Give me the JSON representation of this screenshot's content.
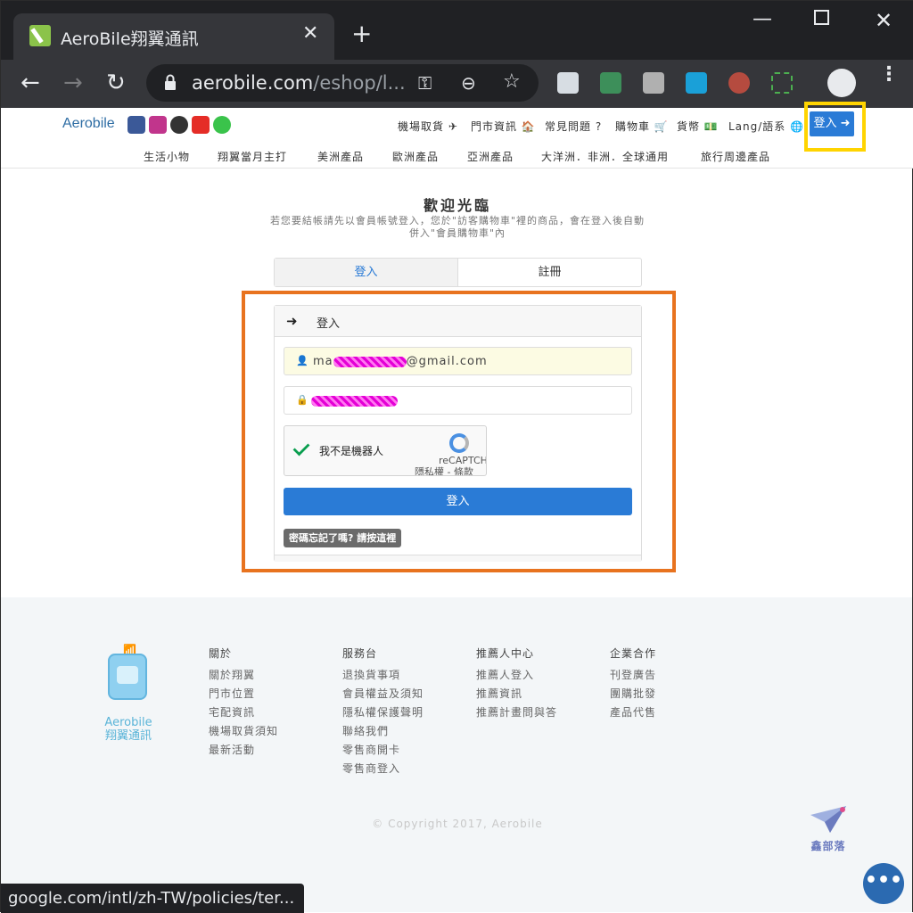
{
  "browser": {
    "tab_title": "AeroBile翔翼通訊",
    "url_main": "aerobile.com",
    "url_path": "/eshop/l...",
    "status_url": "google.com/intl/zh-TW/policies/ter..."
  },
  "site": {
    "brand": "Aerobile",
    "top_nav": [
      {
        "label": "機場取貨 ✈"
      },
      {
        "label": "門市資訊 🏠"
      },
      {
        "label": "常見問題 ?"
      },
      {
        "label": "購物車 🛒"
      },
      {
        "label": "貨幣 💵"
      },
      {
        "label": "Lang/語系 🌐"
      }
    ],
    "login_label": "登入 ➜",
    "categories": [
      "生活小物",
      "翔翼當月主打",
      "美洲產品",
      "歐洲產品",
      "亞洲產品",
      "大洋洲．非洲．全球通用",
      "旅行周邊產品"
    ]
  },
  "main": {
    "welcome": "歡迎光臨",
    "notice": "若您要結帳請先以會員帳號登入，您於\"訪客購物車\"裡的商品，會在登入後自動併入\"會員購物車\"內",
    "tab_login": "登入",
    "tab_register": "註冊",
    "panel_title": "登入",
    "email_prefix": "ma",
    "email_suffix": "@gmail.com",
    "captcha_label": "我不是機器人",
    "captcha_brand": "reCAPTCHA",
    "captcha_links": "隱私權 - 條款",
    "submit_label": "登入",
    "forgot_label": "密碼忘記了嗎? 請按這裡"
  },
  "footer": {
    "mascot_name_1": "Aerobile",
    "mascot_name_2": "翔翼通訊",
    "columns": [
      {
        "title": "關於",
        "links": [
          "關於翔翼",
          "門市位置",
          "宅配資訊",
          "機場取貨須知",
          "最新活動"
        ]
      },
      {
        "title": "服務台",
        "links": [
          "退換貨事項",
          "會員權益及須知",
          "隱私權保護聲明",
          "聯絡我們",
          "零售商開卡",
          "零售商登入"
        ]
      },
      {
        "title": "推薦人中心",
        "links": [
          "推薦人登入",
          "推薦資訊",
          "推薦計畫問與答"
        ]
      },
      {
        "title": "企業合作",
        "links": [
          "刊登廣告",
          "團購批發",
          "產品代售"
        ]
      }
    ],
    "copyright": "© Copyright 2017, Aerobile",
    "watermark": "鑫部落"
  },
  "colors": {
    "accent": "#2a7bd6",
    "highlight_yellow": "#ffd400",
    "highlight_orange": "#e8731f"
  }
}
